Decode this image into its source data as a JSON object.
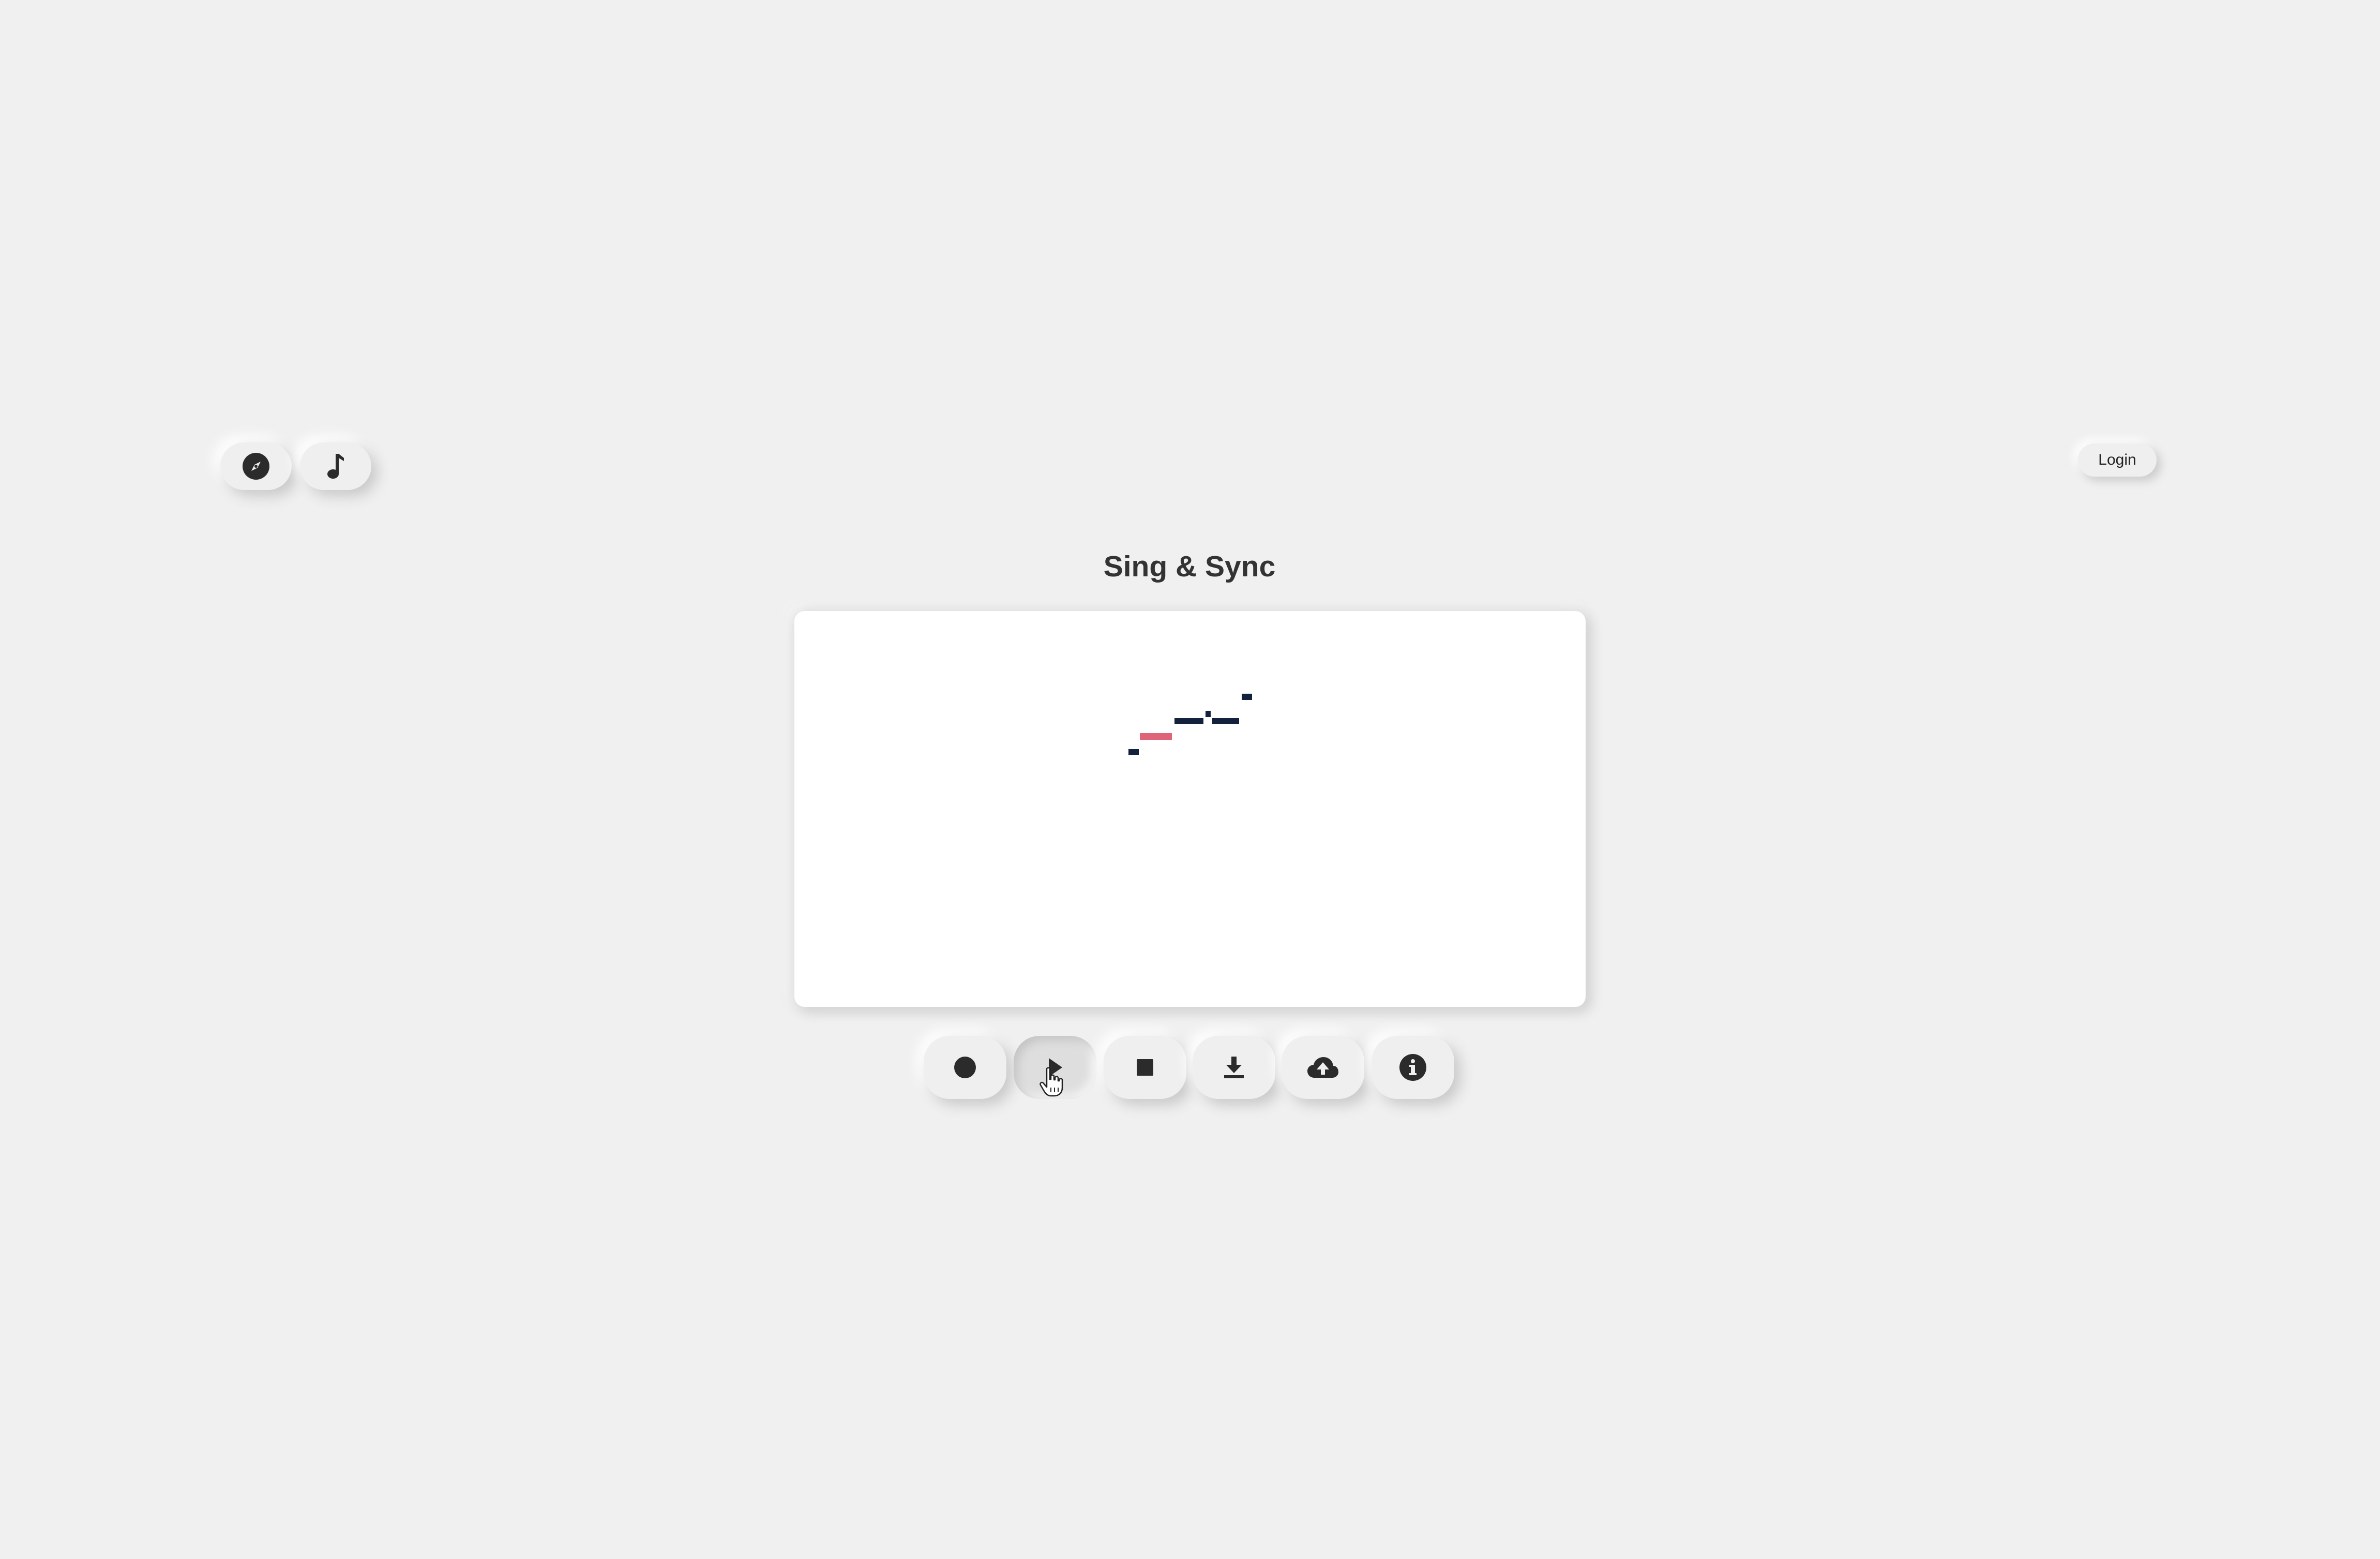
{
  "app": {
    "title": "Sing & Sync"
  },
  "nav": {
    "items": [
      {
        "id": "explore",
        "icon": "compass-icon"
      },
      {
        "id": "music",
        "icon": "music-note-icon"
      }
    ]
  },
  "auth": {
    "login_label": "Login"
  },
  "controls": [
    {
      "id": "record",
      "icon": "record-circle-icon"
    },
    {
      "id": "play",
      "icon": "play-icon",
      "state": "pressed"
    },
    {
      "id": "stop",
      "icon": "stop-square-icon"
    },
    {
      "id": "download",
      "icon": "download-icon"
    },
    {
      "id": "upload",
      "icon": "cloud-upload-icon"
    },
    {
      "id": "info",
      "icon": "info-circle-icon"
    }
  ],
  "colors": {
    "background": "#f0f0f0",
    "icon": "#2b2b2b",
    "note_default": "#14213d",
    "note_active": "#e06479",
    "canvas": "#ffffff"
  }
}
